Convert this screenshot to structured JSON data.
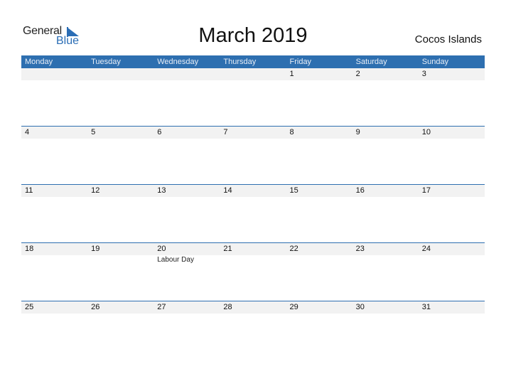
{
  "logo": {
    "word1": "General",
    "word2": "Blue",
    "accent_color": "#2a6db5"
  },
  "title": "March 2019",
  "region": "Cocos Islands",
  "header_color": "#2e6fb0",
  "weekdays": [
    "Monday",
    "Tuesday",
    "Wednesday",
    "Thursday",
    "Friday",
    "Saturday",
    "Sunday"
  ],
  "weeks": [
    {
      "days": [
        "",
        "",
        "",
        "",
        "1",
        "2",
        "3"
      ],
      "events": [
        "",
        "",
        "",
        "",
        "",
        "",
        ""
      ]
    },
    {
      "days": [
        "4",
        "5",
        "6",
        "7",
        "8",
        "9",
        "10"
      ],
      "events": [
        "",
        "",
        "",
        "",
        "",
        "",
        ""
      ]
    },
    {
      "days": [
        "11",
        "12",
        "13",
        "14",
        "15",
        "16",
        "17"
      ],
      "events": [
        "",
        "",
        "",
        "",
        "",
        "",
        ""
      ]
    },
    {
      "days": [
        "18",
        "19",
        "20",
        "21",
        "22",
        "23",
        "24"
      ],
      "events": [
        "",
        "",
        "Labour Day",
        "",
        "",
        "",
        ""
      ]
    },
    {
      "days": [
        "25",
        "26",
        "27",
        "28",
        "29",
        "30",
        "31"
      ],
      "events": [
        "",
        "",
        "",
        "",
        "",
        "",
        ""
      ]
    }
  ]
}
